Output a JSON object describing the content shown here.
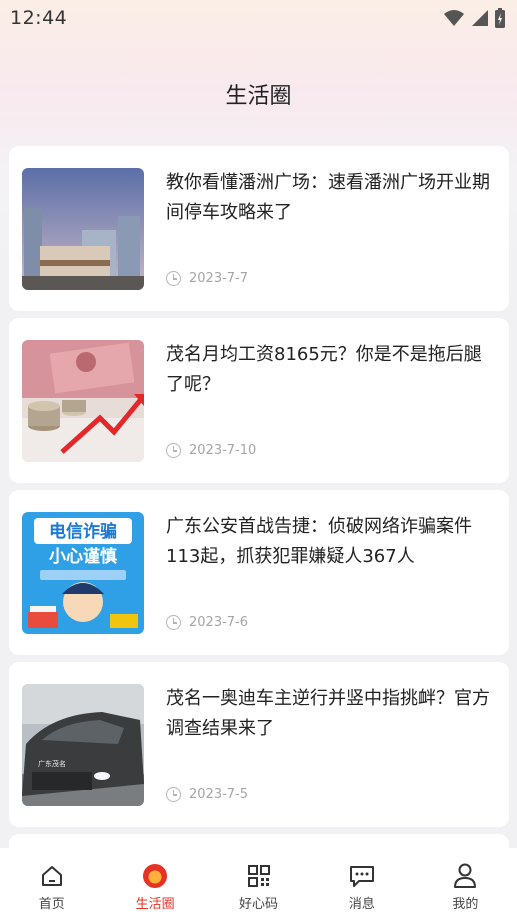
{
  "status_bar": {
    "time": "12:44"
  },
  "header": {
    "title": "生活圈"
  },
  "articles": [
    {
      "title": "教你看懂潘洲广场：速看潘洲广场开业期间停车攻略来了",
      "date": "2023-7-7"
    },
    {
      "title": "茂名月均工资8165元？你是不是拖后腿了呢？",
      "date": "2023-7-10"
    },
    {
      "title": "广东公安首战告捷：侦破网络诈骗案件113起，抓获犯罪嫌疑人367人",
      "date": "2023-7-6"
    },
    {
      "title": "茂名一奥迪车主逆行并竖中指挑衅？官方调查结果来了",
      "date": "2023-7-5"
    }
  ],
  "thumb_text": {
    "fraud_sign_line1": "电信诈骗",
    "fraud_sign_line2": "小心谨慎",
    "car_plate": "广东茂名"
  },
  "tabbar": {
    "items": [
      {
        "label": "首页",
        "icon": "home-icon"
      },
      {
        "label": "生活圈",
        "icon": "life-circle-icon",
        "active": true
      },
      {
        "label": "好心码",
        "icon": "qr-code-icon"
      },
      {
        "label": "消息",
        "icon": "message-icon"
      },
      {
        "label": "我的",
        "icon": "profile-icon"
      }
    ]
  },
  "colors": {
    "accent": "#e53224",
    "card_bg": "#ffffff",
    "page_bg": "#f1f1f3"
  }
}
